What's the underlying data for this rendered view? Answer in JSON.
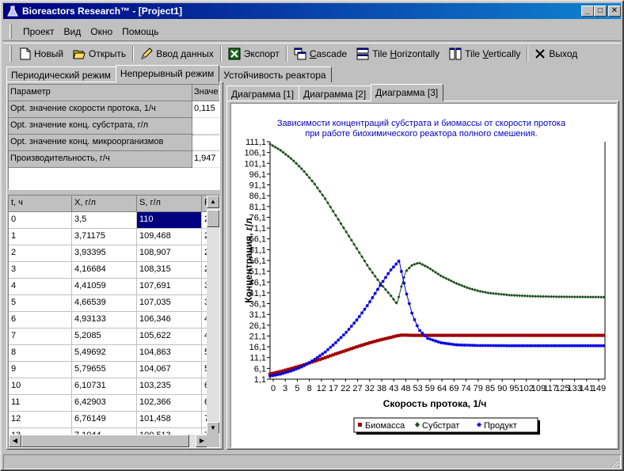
{
  "window": {
    "title": "Bioreactors Research™ - [Project1]",
    "min_glyph": "_",
    "max_glyph": "□",
    "close_glyph": "✕"
  },
  "menu": [
    "Проект",
    "Вид",
    "Окно",
    "Помощь"
  ],
  "toolbar": {
    "new": "Новый",
    "open": "Открыть",
    "input": "Ввод данных",
    "export": "Экспорт",
    "cascade_u": "C",
    "cascade_rest": "ascade",
    "tileh_pre": "Tile ",
    "tileh_u": "H",
    "tileh_rest": "orizontally",
    "tilev_pre": "Tile ",
    "tilev_u": "V",
    "tilev_rest": "ertically",
    "exit": "Выход"
  },
  "main_tabs": [
    "Периодический режим",
    "Непрерывный режим",
    "Устойчивость реактора"
  ],
  "param_grid": {
    "headers": [
      "Параметр",
      "Значе"
    ],
    "rows": [
      [
        "Opt. значение скорости протока, 1/ч",
        "0,115"
      ],
      [
        "Opt. значение конц. субстрата, г/л",
        ""
      ],
      [
        "Opt. значение конц. микроорганизмов",
        ""
      ],
      [
        "Производительность, г/ч",
        "1,947"
      ]
    ]
  },
  "data_grid": {
    "headers": [
      "t, ч",
      "X, г/л",
      "S, г/л",
      "P"
    ],
    "rows": [
      [
        "0",
        "3,5",
        "110",
        "2"
      ],
      [
        "1",
        "3,71175",
        "109,468",
        "2"
      ],
      [
        "2",
        "3,93395",
        "108,907",
        "2"
      ],
      [
        "3",
        "4,16684",
        "108,315",
        "2"
      ],
      [
        "4",
        "4,41059",
        "107,691",
        "3"
      ],
      [
        "5",
        "4,66539",
        "107,035",
        "3"
      ],
      [
        "6",
        "4,93133",
        "106,346",
        "4"
      ],
      [
        "7",
        "5,2085",
        "105,622",
        "4"
      ],
      [
        "8",
        "5,49692",
        "104,863",
        "5"
      ],
      [
        "9",
        "5,79655",
        "104,067",
        "5"
      ],
      [
        "10",
        "6,10731",
        "103,235",
        "6"
      ],
      [
        "11",
        "6,42903",
        "102,366",
        "6"
      ],
      [
        "12",
        "6,76149",
        "101,458",
        "7"
      ],
      [
        "13",
        "7,1044",
        "100,513",
        "7"
      ]
    ]
  },
  "chart_tabs": [
    "Диаграмма [1]",
    "Диаграмма [2]",
    "Диаграмма [3]"
  ],
  "chart_data": {
    "type": "line",
    "title": "Зависимости концентраций субстрата и биомассы от скорости протока при работе биохимического реактора полного смешения.",
    "title_line1": "Зависимости концентраций субстрата и биомассы от скорости протока",
    "title_line2": "при работе биохимического реактора полного смешения.",
    "xlabel": "Скорость протока, 1/ч",
    "ylabel": "Концентрация, г/л",
    "xlim": [
      0,
      153
    ],
    "ylim": [
      1.1,
      111.1
    ],
    "yticks": [
      "111,1",
      "106,1",
      "101,1",
      "96,1",
      "91,1",
      "86,1",
      "81,1",
      "76,1",
      "71,1",
      "66,1",
      "61,1",
      "56,1",
      "51,1",
      "46,1",
      "41,1",
      "36,1",
      "31,1",
      "26,1",
      "21,1",
      "16,1",
      "11,1",
      "6,1",
      "1,1"
    ],
    "xticks": [
      "0",
      "3",
      "5",
      "8",
      "12",
      "17",
      "22",
      "27",
      "32",
      "38",
      "43",
      "48",
      "53",
      "59",
      "64",
      "69",
      "74",
      "79",
      "85",
      "90",
      "95",
      "102",
      "109",
      "117",
      "125",
      "133",
      "141",
      "149"
    ],
    "legend_position": "bottom",
    "series": [
      {
        "name": "Биомасса",
        "color": "#a00000",
        "marker": "square",
        "points": [
          [
            0,
            3.5
          ],
          [
            5,
            4.7
          ],
          [
            10,
            6.1
          ],
          [
            15,
            7.6
          ],
          [
            20,
            9.3
          ],
          [
            25,
            11.0
          ],
          [
            30,
            12.8
          ],
          [
            35,
            14.5
          ],
          [
            40,
            16.2
          ],
          [
            45,
            17.8
          ],
          [
            50,
            19.2
          ],
          [
            55,
            20.4
          ],
          [
            58,
            21.2
          ],
          [
            60,
            21.5
          ],
          [
            62,
            21.5
          ],
          [
            65,
            21.4
          ],
          [
            70,
            21.4
          ],
          [
            80,
            21.4
          ],
          [
            90,
            21.4
          ],
          [
            100,
            21.4
          ],
          [
            110,
            21.4
          ],
          [
            120,
            21.4
          ],
          [
            130,
            21.4
          ],
          [
            140,
            21.4
          ],
          [
            150,
            21.4
          ],
          [
            153,
            21.4
          ]
        ]
      },
      {
        "name": "Субстрат",
        "color": "#1f4f1f",
        "marker": "diamond",
        "points": [
          [
            0,
            110
          ],
          [
            5,
            107
          ],
          [
            10,
            103
          ],
          [
            15,
            98
          ],
          [
            20,
            92
          ],
          [
            25,
            85
          ],
          [
            30,
            77
          ],
          [
            35,
            69
          ],
          [
            40,
            61
          ],
          [
            45,
            53
          ],
          [
            50,
            46
          ],
          [
            55,
            40
          ],
          [
            58,
            36
          ],
          [
            60,
            44
          ],
          [
            62,
            51
          ],
          [
            65,
            54
          ],
          [
            68,
            55
          ],
          [
            72,
            53
          ],
          [
            78,
            49
          ],
          [
            85,
            45.5
          ],
          [
            90,
            43.5
          ],
          [
            95,
            42
          ],
          [
            100,
            41
          ],
          [
            110,
            40
          ],
          [
            120,
            39.5
          ],
          [
            130,
            39.3
          ],
          [
            140,
            39.2
          ],
          [
            153,
            39.1
          ]
        ]
      },
      {
        "name": "Продукт",
        "color": "#0000e0",
        "marker": "asterisk",
        "points": [
          [
            0,
            2.5
          ],
          [
            5,
            3.5
          ],
          [
            10,
            5
          ],
          [
            15,
            7
          ],
          [
            20,
            10
          ],
          [
            25,
            13.5
          ],
          [
            30,
            18
          ],
          [
            35,
            23
          ],
          [
            40,
            29
          ],
          [
            45,
            36
          ],
          [
            50,
            44
          ],
          [
            55,
            51.5
          ],
          [
            59,
            56
          ],
          [
            60,
            51
          ],
          [
            62,
            42
          ],
          [
            65,
            31
          ],
          [
            68,
            24
          ],
          [
            72,
            20
          ],
          [
            78,
            18
          ],
          [
            85,
            17
          ],
          [
            95,
            16.7
          ],
          [
            110,
            16.6
          ],
          [
            130,
            16.6
          ],
          [
            153,
            16.6
          ]
        ]
      }
    ]
  }
}
